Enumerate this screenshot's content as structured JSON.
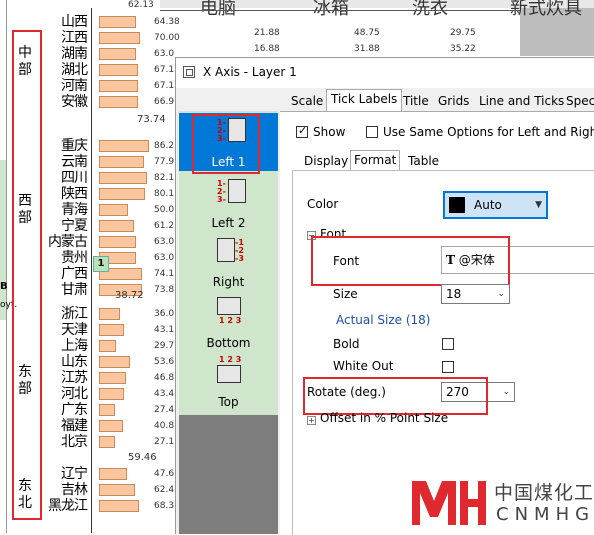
{
  "background_chart": {
    "header_values": {
      "top_left": "62.13"
    },
    "column_headers": [
      "电脑",
      "冰箱",
      "洗衣",
      "新式炊具"
    ],
    "table_rows": [
      [
        "64.38",
        "21.88",
        "48.75",
        "29.75"
      ],
      [
        "70.00",
        "16.88",
        "31.88",
        "35.22"
      ]
    ],
    "regions": [
      {
        "name": "中部",
        "provinces": [
          "山西",
          "江西",
          "湖南",
          "湖北",
          "河南",
          "安徽"
        ],
        "values": [
          "64.38",
          "70.00",
          "63.0",
          "67.1",
          "67.1",
          "66.9"
        ]
      },
      {
        "name": "西部",
        "provinces": [
          "重庆",
          "云南",
          "四川",
          "陕西",
          "青海",
          "宁夏",
          "内蒙古",
          "贵州",
          "广西",
          "甘肃"
        ],
        "values": [
          "86.2",
          "77.9",
          "82.1",
          "80.1",
          "50.0",
          "61.2",
          "63.0",
          "63.0",
          "74.1",
          "73.8"
        ],
        "sub_value": "73.74",
        "bottom_value": "38.72"
      },
      {
        "name": "东部",
        "provinces": [
          "浙江",
          "天津",
          "上海",
          "山东",
          "江苏",
          "河北",
          "广东",
          "福建",
          "北京"
        ],
        "values": [
          "36.0",
          "43.1",
          "29.7",
          "53.6",
          "46.8",
          "43.4",
          "27.4",
          "40.8",
          "27.1"
        ],
        "bottom_value": "59.46"
      },
      {
        "name": "东北",
        "provinces": [
          "辽宁",
          "吉林",
          "黑龙江"
        ],
        "values": [
          "47.6",
          "62.4",
          "68.3"
        ]
      }
    ],
    "badge": "1",
    "side_text": "B",
    "side_text2": "oyt."
  },
  "dialog": {
    "title": "X Axis - Layer 1",
    "left_items": [
      {
        "label": "Left 1",
        "selected": true
      },
      {
        "label": "Left 2",
        "selected": false
      },
      {
        "label": "Right",
        "selected": false
      },
      {
        "label": "Bottom",
        "selected": false
      },
      {
        "label": "Top",
        "selected": false
      }
    ],
    "tabs": [
      "Scale",
      "Tick Labels",
      "Title",
      "Grids",
      "Line and Ticks",
      "Speci"
    ],
    "selected_tab": "Tick Labels",
    "show_label": "Show",
    "same_options_label": "Use Same Options for Left and Right",
    "subtabs": [
      "Display",
      "Format",
      "Table"
    ],
    "selected_subtab": "Format",
    "color": {
      "label": "Color",
      "value": "Auto",
      "swatch": "#000000"
    },
    "font_group_label": "Font",
    "font": {
      "label": "Font",
      "value": "@宋体"
    },
    "size": {
      "label": "Size",
      "value": "18"
    },
    "actual_size_label": "Actual Size (18)",
    "bold_label": "Bold",
    "white_out_label": "White Out",
    "rotate": {
      "label": "Rotate (deg.)",
      "value": "270"
    },
    "offset_label": "Offset in % Point Size"
  },
  "watermark": {
    "cn": "中国煤化工",
    "en": "CNMHG",
    "brand_color": "#e0292e"
  },
  "colors": {
    "highlight": "#e0292e",
    "selection": "#0078d7",
    "left_pane": "#cfe6cc",
    "bar": "#f9c6a0"
  }
}
